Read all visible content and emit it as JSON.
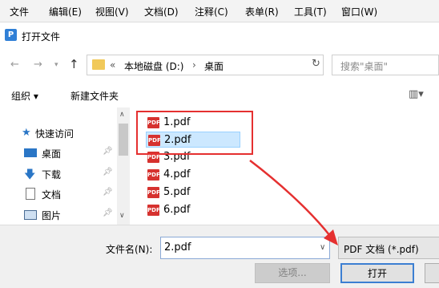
{
  "menubar": {
    "items": [
      "文件",
      "编辑(E)",
      "视图(V)",
      "文档(D)",
      "注释(C)",
      "表单(R)",
      "工具(T)",
      "窗口(W)"
    ]
  },
  "dialog": {
    "title": "打开文件"
  },
  "address": {
    "prefix": "«",
    "path": [
      "本地磁盘 (D:)",
      "桌面"
    ],
    "separator": "›"
  },
  "search": {
    "placeholder": "搜索\"桌面\""
  },
  "toolbar": {
    "organize_label": "组织 ▾",
    "new_folder_label": "新建文件夹"
  },
  "navpane": {
    "quick_access": "快速访问",
    "items": [
      {
        "label": "桌面",
        "icon": "desktop-icon"
      },
      {
        "label": "下载",
        "icon": "download-icon"
      },
      {
        "label": "文档",
        "icon": "document-icon"
      },
      {
        "label": "图片",
        "icon": "picture-icon"
      }
    ]
  },
  "files": [
    {
      "name": "1.pdf",
      "selected": false
    },
    {
      "name": "2.pdf",
      "selected": true
    },
    {
      "name": "3.pdf",
      "selected": false
    },
    {
      "name": "4.pdf",
      "selected": false
    },
    {
      "name": "5.pdf",
      "selected": false
    },
    {
      "name": "6.pdf",
      "selected": false
    }
  ],
  "pdf_icon_text": "PDF",
  "filename": {
    "label": "文件名(N):",
    "value": "2.pdf"
  },
  "filetype": {
    "selected": "PDF 文档 (*.pdf)"
  },
  "buttons": {
    "options": "选项...",
    "open": "打开"
  },
  "colors": {
    "highlight_box": "#e53030",
    "arrow": "#e53030",
    "selection_bg": "#cce8ff",
    "pdf_icon": "#d6322f"
  }
}
